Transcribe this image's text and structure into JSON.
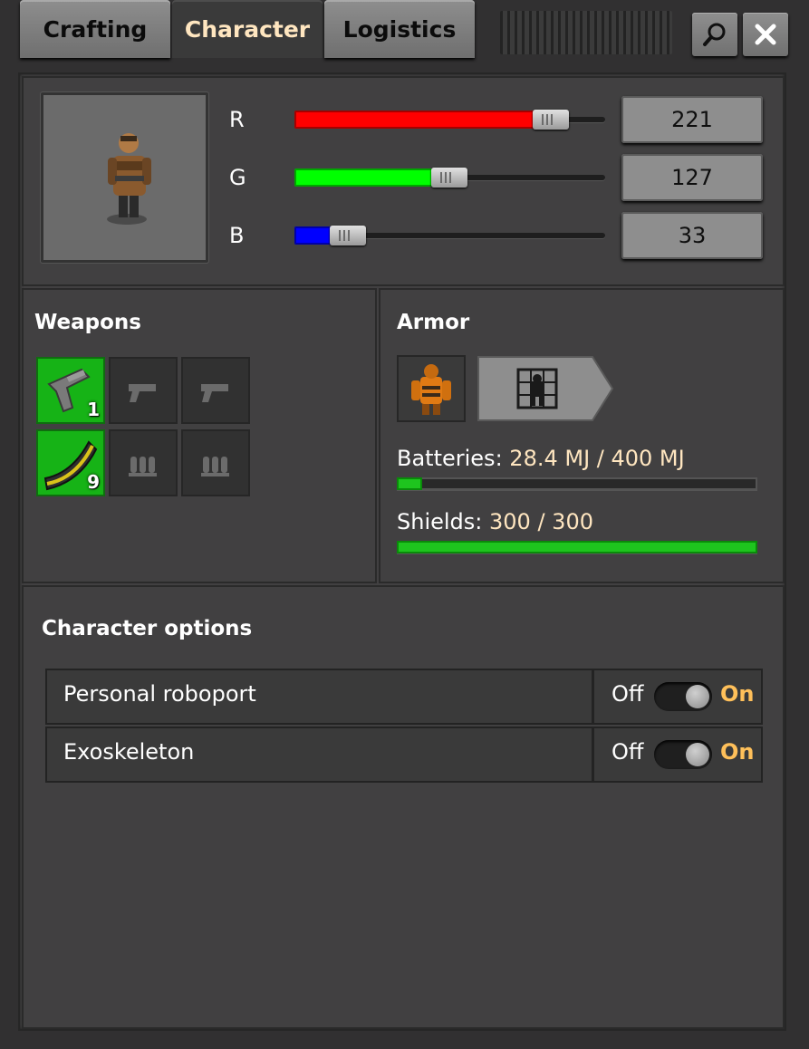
{
  "tabs": [
    {
      "label": "Crafting"
    },
    {
      "label": "Character"
    },
    {
      "label": "Logistics"
    }
  ],
  "titlebar": {
    "search_icon": "search-icon",
    "close_icon": "close-icon"
  },
  "color": {
    "channels": [
      {
        "label": "R",
        "value": "221",
        "fraction": 0.867,
        "color": "#ff0000"
      },
      {
        "label": "G",
        "value": "127",
        "fraction": 0.498,
        "color": "#00ff00"
      },
      {
        "label": "B",
        "value": "33",
        "fraction": 0.129,
        "color": "#0000ff"
      }
    ]
  },
  "weapons": {
    "title": "Weapons",
    "gun_slots": [
      {
        "item": "pistol-icon",
        "count": "1",
        "filled": true
      },
      {
        "item": "pistol-placeholder-icon",
        "count": "",
        "filled": false
      },
      {
        "item": "pistol-placeholder-icon",
        "count": "",
        "filled": false
      }
    ],
    "ammo_slots": [
      {
        "item": "ammo-magazine-icon",
        "count": "9",
        "filled": true
      },
      {
        "item": "ammo-placeholder-icon",
        "count": "",
        "filled": false
      },
      {
        "item": "ammo-placeholder-icon",
        "count": "",
        "filled": false
      }
    ]
  },
  "armor": {
    "title": "Armor",
    "slot_icon": "power-armor-icon",
    "grid_button_icon": "equipment-grid-icon",
    "batteries_label": "Batteries:",
    "batteries_value": "28.4 MJ / 400 MJ",
    "batteries_fraction": 0.071,
    "shields_label": "Shields:",
    "shields_value": "300 / 300",
    "shields_fraction": 1.0
  },
  "options": {
    "title": "Character options",
    "rows": [
      {
        "name": "Personal roboport",
        "off": "Off",
        "on": "On",
        "state": "on"
      },
      {
        "name": "Exoskeleton",
        "off": "Off",
        "on": "On",
        "state": "on"
      }
    ]
  }
}
